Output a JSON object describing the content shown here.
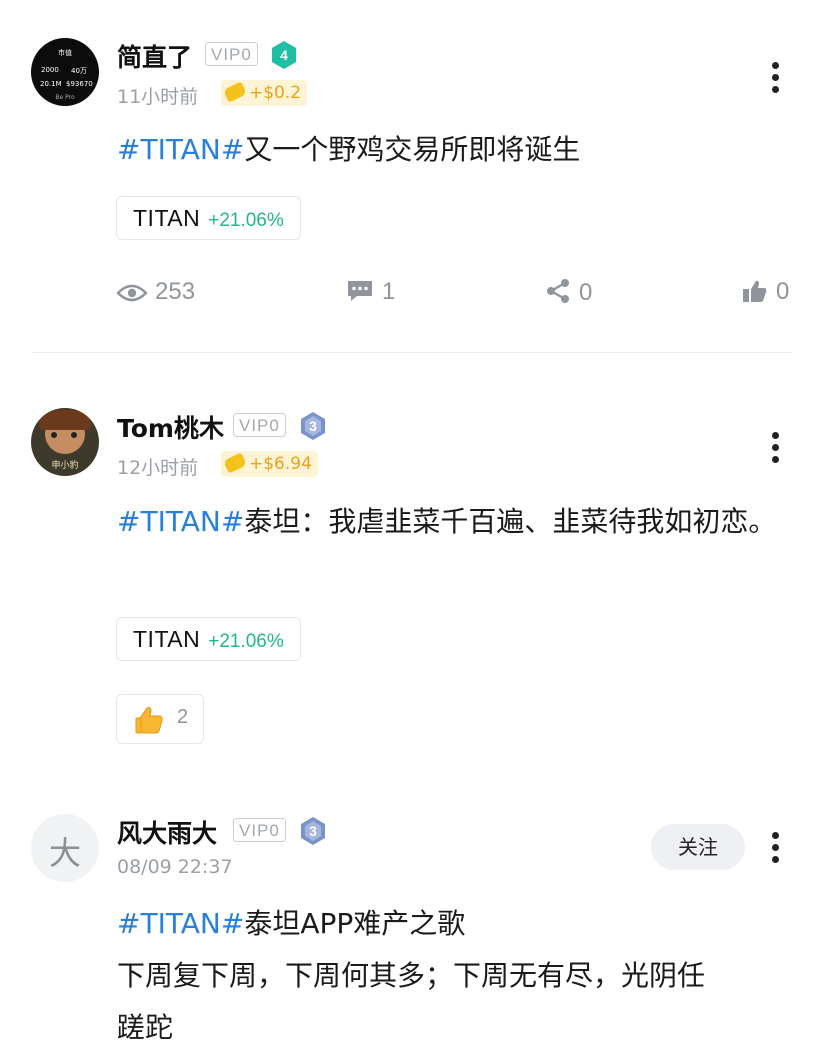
{
  "posts": [
    {
      "author": "简直了",
      "vip": "VIP0",
      "level": "4",
      "time": "11小时前",
      "reward": "+$0.2",
      "text_tag": "#TITAN#",
      "text": "又一个野鸡交易所即将诞生",
      "stock": {
        "symbol": "TITAN",
        "change": "+21.06%"
      },
      "stats": {
        "views": "253",
        "comments": "1",
        "shares": "0",
        "likes": "0"
      },
      "avatar": {
        "title": "市值",
        "cells": [
          "2000",
          "40万",
          "20.1M",
          "$93670"
        ],
        "footer": "Be Pro"
      }
    },
    {
      "author": "Tom桃木",
      "vip": "VIP0",
      "level": "3",
      "time": "12小时前",
      "reward": "+$6.94",
      "text_tag": "#TITAN#",
      "text": "泰坦：我虐韭菜千百遍、韭菜待我如初恋。",
      "stock": {
        "symbol": "TITAN",
        "change": "+21.06%"
      },
      "reaction": {
        "icon": "thumbs-up-emoji",
        "count": "2"
      },
      "avatar": {
        "caption": "申小豹"
      }
    },
    {
      "author": "风大雨大",
      "vip": "VIP0",
      "level": "3",
      "time": "08/09 22:37",
      "follow_label": "关注",
      "avatar_char": "大",
      "text_tag": "#TITAN#",
      "text_line1": "泰坦APP难产之歌",
      "text_line2": "下周复下周，下周何其多；下周无有尽，光阴任",
      "text_line3": "蹉跎"
    }
  ],
  "colors": {
    "tag": "#2a80d9",
    "gain": "#1fb981",
    "reward": "#e8a317",
    "level4": "#1fbfa4",
    "level3": "#7b93c9"
  }
}
